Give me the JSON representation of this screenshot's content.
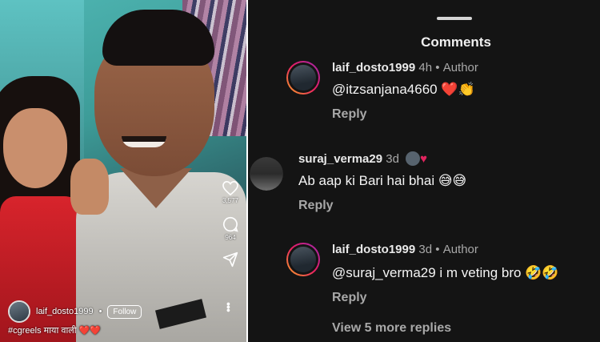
{
  "reel": {
    "username": "laif_dosto1999",
    "separator": "•",
    "follow_label": "Follow",
    "caption": "#cgreels माया वाली ❤️❤️",
    "like_count": "3,577",
    "comment_count": "964",
    "icons": [
      "heart-icon",
      "comment-icon",
      "share-icon",
      "more-icon"
    ]
  },
  "sheet": {
    "title": "Comments",
    "comments": [
      {
        "username": "laif_dosto1999",
        "time": "4h",
        "dot": "•",
        "badge": "Author",
        "text": "@itzsanjana4660 ❤️👏",
        "reply": "Reply"
      },
      {
        "username": "suraj_verma29",
        "time": "3d",
        "text": "Ab aap ki Bari hai bhai 😅😅",
        "reply": "Reply"
      },
      {
        "username": "laif_dosto1999",
        "time": "3d",
        "dot": "•",
        "badge": "Author",
        "text": "@suraj_verma29 i m veting bro 🤣🤣",
        "reply": "Reply"
      }
    ],
    "view_more": "View 5 more replies"
  },
  "colors": {
    "sheet_bg": "#141414",
    "muted_text": "#a8a8a8",
    "heart": "#e0245e"
  }
}
